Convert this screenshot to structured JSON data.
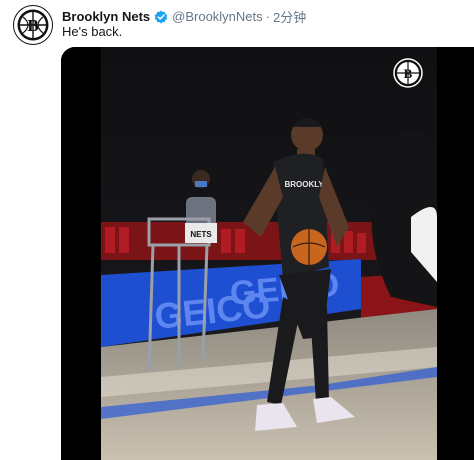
{
  "tweet": {
    "author_name": "Brooklyn Nets",
    "handle": "@BrooklynNets",
    "separator": "·",
    "timestamp": "2分钟",
    "text": "He's back.",
    "verified": true
  },
  "media": {
    "type": "video",
    "watermark_icon": "nets-b-logo-icon",
    "signage_left": "GEICO",
    "signage_right": "GEICO",
    "jersey_text": "BROOKLYN",
    "chair_sign": "NETS"
  },
  "icons": {
    "avatar": "nets-b-logo-icon",
    "verified": "verified-badge-icon"
  },
  "colors": {
    "verified_blue": "#1da1f2",
    "geico_blue": "#1d4fd0",
    "court_tan": "#b8ae9e"
  }
}
